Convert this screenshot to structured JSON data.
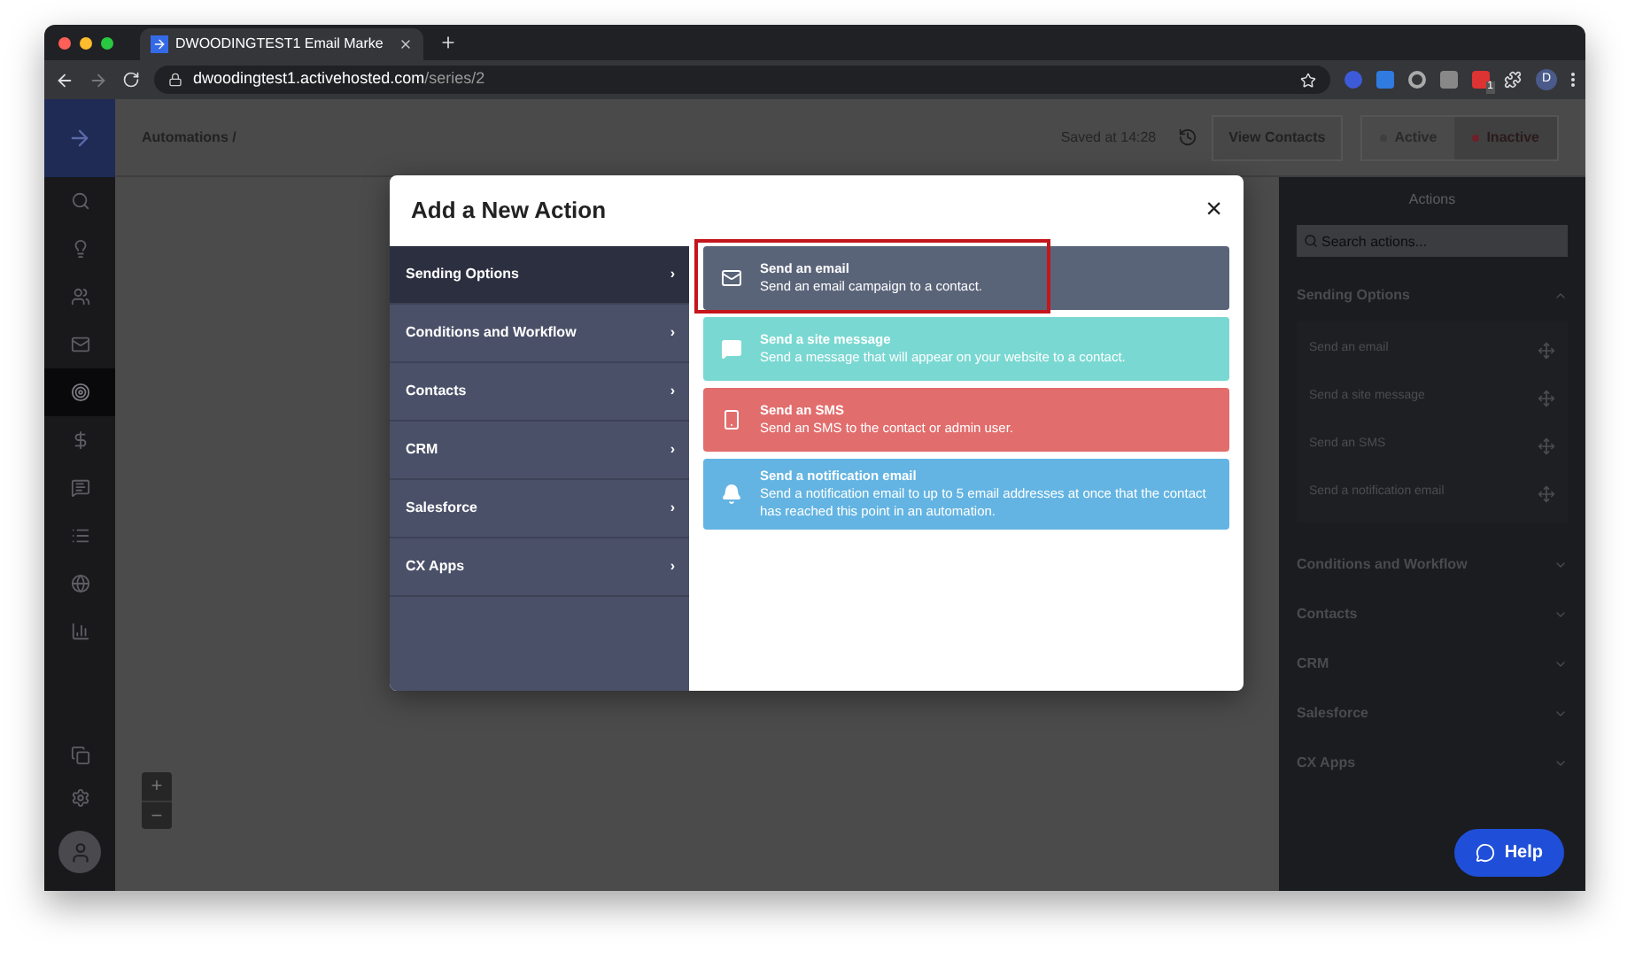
{
  "browser": {
    "tab_title": "DWOODINGTEST1 Email Marke",
    "url_host": "dwoodingtest1.activehosted.com",
    "url_path": "/series/2",
    "extension_badge": "1",
    "profile": "D"
  },
  "rail": [
    {
      "kind": "search",
      "selected": false
    },
    {
      "kind": "ideas",
      "selected": false
    },
    {
      "kind": "contacts",
      "selected": false
    },
    {
      "kind": "campaigns",
      "selected": false
    },
    {
      "kind": "automations",
      "selected": true
    },
    {
      "kind": "deals",
      "selected": false
    },
    {
      "kind": "conversations",
      "selected": false
    },
    {
      "kind": "lists",
      "selected": false
    },
    {
      "kind": "site",
      "selected": false
    },
    {
      "kind": "reports",
      "selected": false
    }
  ],
  "topbar": {
    "breadcrumb": "Automations /",
    "saved": "Saved at 14:28",
    "view_contacts": "View Contacts",
    "status": [
      {
        "label": "Active",
        "selected": false,
        "color": "#3f3f3f"
      },
      {
        "label": "Inactive",
        "selected": true,
        "color": "#6e1f2a"
      }
    ]
  },
  "zoom": {
    "in": "+",
    "out": "−"
  },
  "modal": {
    "title": "Add a New Action",
    "close": "×",
    "categories": [
      {
        "label": "Sending Options",
        "selected": true,
        "arrow": "›"
      },
      {
        "label": "Conditions and Workflow",
        "selected": false,
        "arrow": "›"
      },
      {
        "label": "Contacts",
        "selected": false,
        "arrow": "›"
      },
      {
        "label": "CRM",
        "selected": false,
        "arrow": "›"
      },
      {
        "label": "Salesforce",
        "selected": false,
        "arrow": "›"
      },
      {
        "label": "CX Apps",
        "selected": false,
        "arrow": "›"
      }
    ],
    "actions": [
      {
        "kind": "email",
        "title": "Send an email",
        "description": "Send an email campaign to a contact.",
        "highlighted": true
      },
      {
        "kind": "site",
        "title": "Send a site message",
        "description": "Send a message that will appear on your website to a contact.",
        "highlighted": false
      },
      {
        "kind": "sms",
        "title": "Send an SMS",
        "description": "Send an SMS to the contact or admin user.",
        "highlighted": false
      },
      {
        "kind": "notification",
        "title": "Send a notification email",
        "description": "Send a notification email to up to 5 email addresses at once that the contact has reached this point in an automation.",
        "highlighted": false
      }
    ]
  },
  "panel": {
    "title": "Actions",
    "search": {
      "placeholder": "Search actions..."
    },
    "groups": [
      {
        "label": "Sending Options",
        "expanded": true,
        "items": [
          "Send an email",
          "Send a site message",
          "Send an SMS",
          "Send a notification email"
        ]
      },
      {
        "label": "Conditions and Workflow",
        "expanded": false
      },
      {
        "label": "Contacts",
        "expanded": false
      },
      {
        "label": "CRM",
        "expanded": false
      },
      {
        "label": "Salesforce",
        "expanded": false
      },
      {
        "label": "CX Apps",
        "expanded": false
      }
    ]
  },
  "help": "Help"
}
